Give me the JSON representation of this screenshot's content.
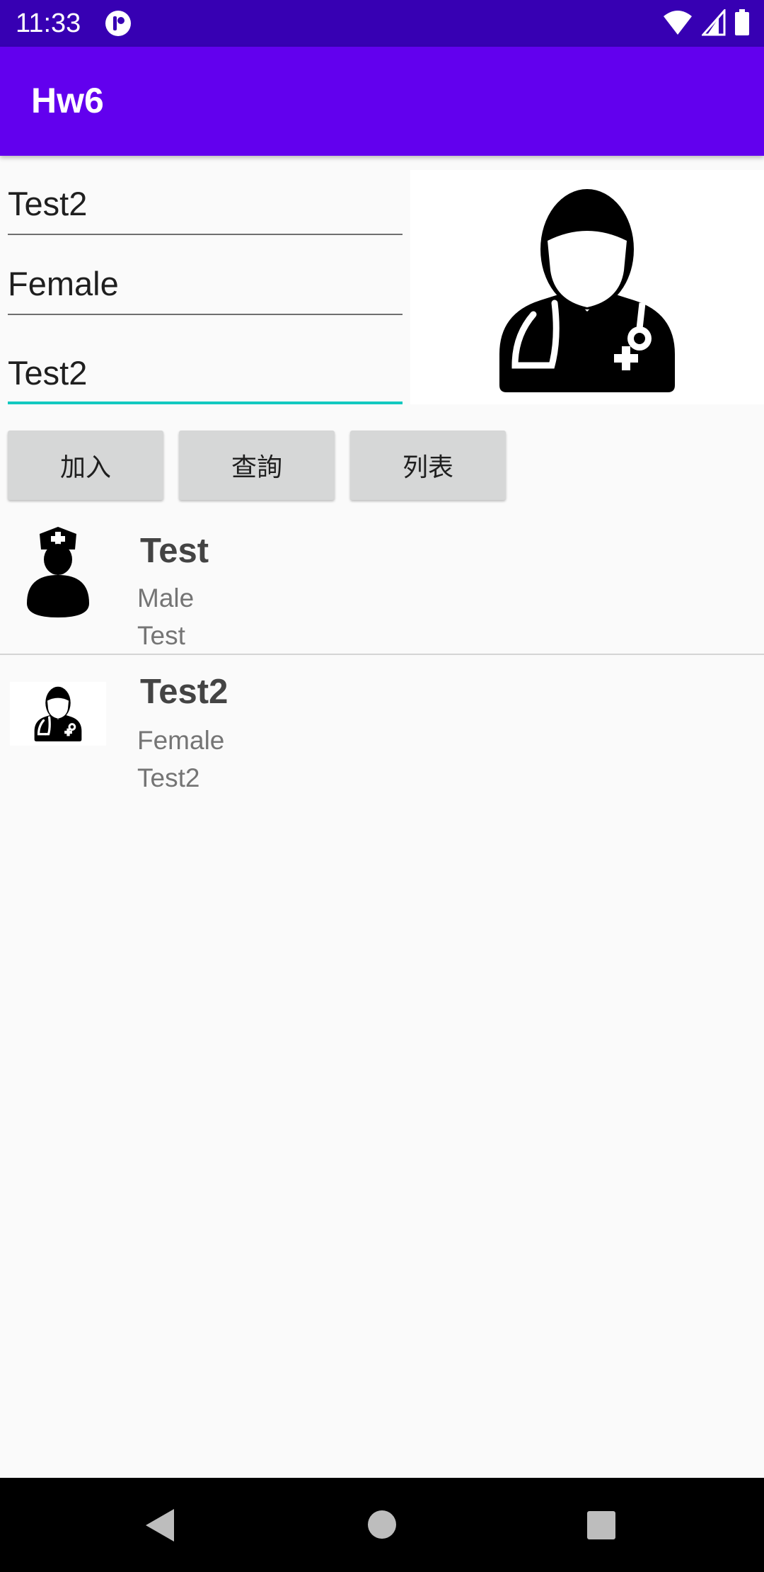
{
  "status_bar": {
    "time": "11:33"
  },
  "app_bar": {
    "title": "Hw6"
  },
  "form": {
    "name_value": "Test2",
    "gender_value": "Female",
    "note_value": "Test2"
  },
  "buttons": {
    "add_label": "加入",
    "query_label": "查詢",
    "list_label": "列表"
  },
  "records": [
    {
      "name": "Test",
      "gender": "Male",
      "note": "Test",
      "icon": "nurse-icon"
    },
    {
      "name": "Test2",
      "gender": "Female",
      "note": "Test2",
      "icon": "doctor-icon"
    }
  ],
  "colors": {
    "status_bar": "#3700b3",
    "app_bar": "#6200ee",
    "focus_accent": "#12c9c0"
  }
}
